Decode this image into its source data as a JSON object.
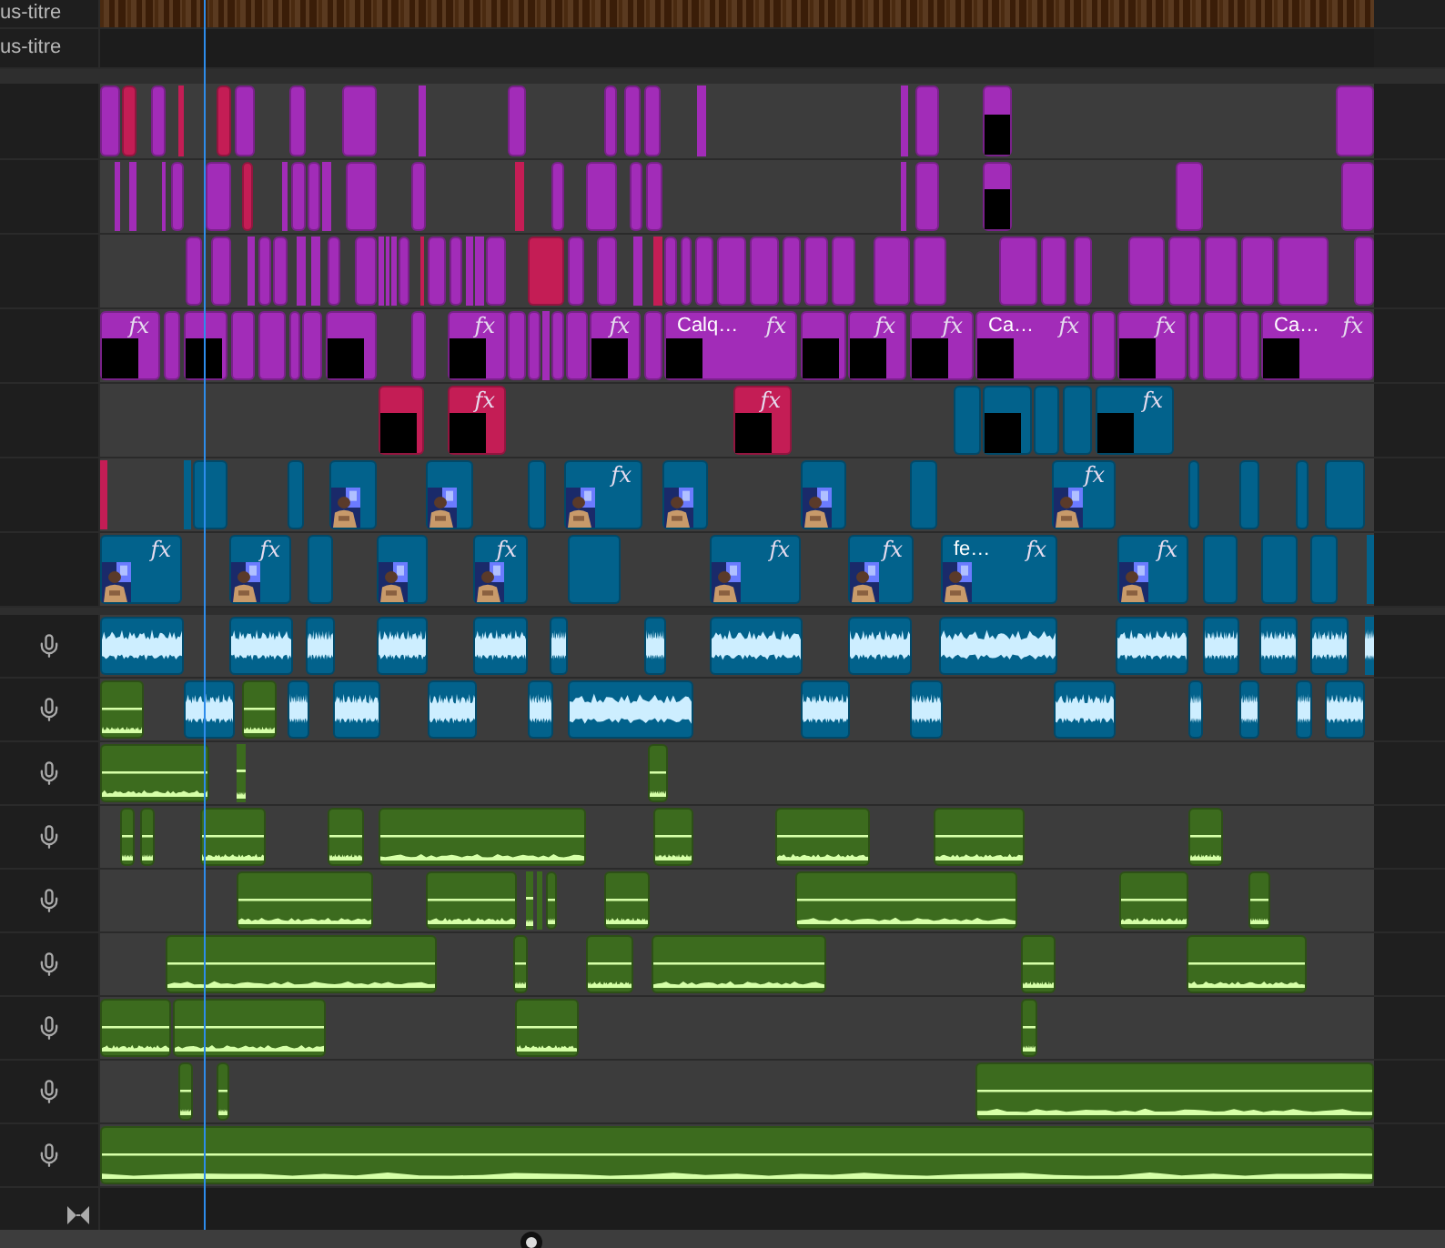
{
  "subtitle_tracks": [
    {
      "label": "us-titre"
    },
    {
      "label": "us-titre"
    }
  ],
  "video_tracks": [
    {
      "clips": [
        {
          "color": "#a22cb8"
        },
        {
          "color": "#c41d55"
        },
        {
          "color": "#a22cb8"
        },
        {
          "color": "#c41d55"
        },
        {
          "color": "#c41d55"
        },
        {
          "color": "#a22cb8"
        },
        {
          "color": "#a22cb8"
        },
        {
          "color": "#a22cb8"
        },
        {
          "color": "#a22cb8"
        },
        {
          "color": "#a22cb8"
        },
        {
          "color": "#a22cb8"
        },
        {
          "color": "#a22cb8"
        },
        {
          "color": "#a22cb8"
        },
        {
          "color": "#a22cb8"
        },
        {
          "color": "#a22cb8"
        },
        {
          "color": "#a22cb8"
        },
        {
          "color": "#a22cb8",
          "kind": "dark"
        },
        {
          "color": "#a22cb8"
        }
      ]
    },
    {
      "clips": [
        {
          "color": "#a22cb8"
        },
        {
          "color": "#a22cb8"
        },
        {
          "color": "#a22cb8"
        },
        {
          "color": "#a22cb8"
        },
        {
          "color": "#a22cb8"
        },
        {
          "color": "#c41d55"
        },
        {
          "color": "#a22cb8"
        },
        {
          "color": "#a22cb8"
        },
        {
          "color": "#a22cb8"
        },
        {
          "color": "#a22cb8"
        },
        {
          "color": "#a22cb8"
        },
        {
          "color": "#a22cb8"
        },
        {
          "color": "#c41d55"
        },
        {
          "color": "#a22cb8"
        },
        {
          "color": "#a22cb8"
        },
        {
          "color": "#a22cb8"
        },
        {
          "color": "#a22cb8"
        },
        {
          "color": "#a22cb8"
        },
        {
          "color": "#a22cb8"
        },
        {
          "color": "#a22cb8",
          "kind": "dark"
        },
        {
          "color": "#a22cb8"
        },
        {
          "color": "#a22cb8"
        }
      ]
    },
    {
      "clips": [
        {
          "color": "#a22cb8"
        },
        {
          "color": "#a22cb8"
        },
        {
          "color": "#a22cb8"
        },
        {
          "color": "#a22cb8"
        },
        {
          "color": "#a22cb8"
        },
        {
          "color": "#a22cb8"
        },
        {
          "color": "#a22cb8"
        },
        {
          "color": "#a22cb8"
        },
        {
          "color": "#a22cb8"
        },
        {
          "color": "#a22cb8"
        },
        {
          "color": "#a22cb8"
        },
        {
          "color": "#a22cb8"
        },
        {
          "color": "#a22cb8"
        },
        {
          "color": "#c41d55"
        },
        {
          "color": "#a22cb8"
        },
        {
          "color": "#a22cb8"
        },
        {
          "color": "#a22cb8"
        },
        {
          "color": "#a22cb8"
        },
        {
          "color": "#a22cb8"
        },
        {
          "color": "#c41d55"
        },
        {
          "color": "#a22cb8"
        },
        {
          "color": "#a22cb8"
        },
        {
          "color": "#a22cb8"
        },
        {
          "color": "#c41d55"
        },
        {
          "color": "#a22cb8"
        },
        {
          "color": "#a22cb8"
        },
        {
          "color": "#a22cb8"
        },
        {
          "color": "#a22cb8"
        },
        {
          "color": "#a22cb8"
        },
        {
          "color": "#a22cb8"
        },
        {
          "color": "#a22cb8"
        },
        {
          "color": "#a22cb8"
        },
        {
          "color": "#a22cb8"
        },
        {
          "color": "#a22cb8"
        },
        {
          "color": "#a22cb8"
        },
        {
          "color": "#a22cb8"
        },
        {
          "color": "#a22cb8"
        },
        {
          "color": "#a22cb8"
        },
        {
          "color": "#a22cb8"
        },
        {
          "color": "#a22cb8"
        },
        {
          "color": "#a22cb8"
        },
        {
          "color": "#a22cb8"
        },
        {
          "color": "#a22cb8"
        }
      ]
    },
    {
      "clips": [
        {
          "color": "#a22cb8",
          "effect": "fx",
          "kind": "dark"
        },
        {
          "color": "#a22cb8"
        },
        {
          "color": "#a22cb8",
          "kind": "dark"
        },
        {
          "color": "#a22cb8"
        },
        {
          "color": "#a22cb8"
        },
        {
          "color": "#a22cb8"
        },
        {
          "color": "#a22cb8"
        },
        {
          "color": "#a22cb8",
          "kind": "dark"
        },
        {
          "color": "#a22cb8"
        },
        {
          "color": "#a22cb8",
          "effect": "fx",
          "kind": "dark"
        },
        {
          "color": "#a22cb8"
        },
        {
          "color": "#a22cb8"
        },
        {
          "color": "#a22cb8"
        },
        {
          "color": "#a22cb8"
        },
        {
          "color": "#a22cb8"
        },
        {
          "color": "#a22cb8",
          "effect": "fx",
          "kind": "dark"
        },
        {
          "color": "#a22cb8"
        },
        {
          "color": "#a22cb8",
          "label": "Calq…",
          "effect": "fx",
          "kind": "dark"
        },
        {
          "color": "#a22cb8",
          "kind": "dark"
        },
        {
          "color": "#a22cb8",
          "effect": "fx",
          "kind": "dark"
        },
        {
          "color": "#a22cb8",
          "effect": "fx",
          "kind": "dark"
        },
        {
          "color": "#a22cb8",
          "label": "Ca…",
          "effect": "fx",
          "kind": "dark"
        },
        {
          "color": "#a22cb8"
        },
        {
          "color": "#a22cb8",
          "effect": "fx",
          "kind": "dark"
        },
        {
          "color": "#a22cb8"
        },
        {
          "color": "#a22cb8"
        },
        {
          "color": "#a22cb8"
        },
        {
          "color": "#a22cb8",
          "label": "Ca…",
          "effect": "fx",
          "kind": "dark"
        }
      ]
    },
    {
      "clips": [
        {
          "color": "#c41d55",
          "kind": "dark"
        },
        {
          "color": "#c41d55",
          "effect": "fx",
          "kind": "dark"
        },
        {
          "color": "#c41d55",
          "effect": "fx",
          "kind": "dark"
        },
        {
          "color": "#02628c"
        },
        {
          "color": "#02628c",
          "kind": "dark"
        },
        {
          "color": "#02628c"
        },
        {
          "color": "#02628c"
        },
        {
          "color": "#02628c",
          "effect": "fx",
          "kind": "dark"
        }
      ]
    },
    {
      "clips": [
        {
          "color": "#c41d55"
        },
        {
          "color": "#02628c"
        },
        {
          "color": "#02628c"
        },
        {
          "color": "#02628c"
        },
        {
          "color": "#02628c",
          "kind": "picture"
        },
        {
          "color": "#02628c",
          "kind": "picture"
        },
        {
          "color": "#02628c"
        },
        {
          "color": "#02628c",
          "effect": "fx",
          "kind": "picture"
        },
        {
          "color": "#02628c",
          "kind": "picture"
        },
        {
          "color": "#02628c",
          "kind": "picture"
        },
        {
          "color": "#02628c"
        },
        {
          "color": "#02628c",
          "effect": "fx",
          "kind": "picture"
        },
        {
          "color": "#02628c"
        },
        {
          "color": "#02628c"
        },
        {
          "color": "#02628c"
        },
        {
          "color": "#02628c"
        }
      ]
    },
    {
      "clips": [
        {
          "color": "#02628c",
          "effect": "fx",
          "kind": "picture"
        },
        {
          "color": "#02628c",
          "effect": "fx",
          "kind": "picture"
        },
        {
          "color": "#02628c"
        },
        {
          "color": "#02628c",
          "kind": "picture"
        },
        {
          "color": "#02628c",
          "effect": "fx",
          "kind": "picture"
        },
        {
          "color": "#02628c"
        },
        {
          "color": "#02628c",
          "effect": "fx",
          "kind": "picture"
        },
        {
          "color": "#02628c",
          "effect": "fx",
          "kind": "picture"
        },
        {
          "color": "#02628c",
          "label": "fe…",
          "effect": "fx",
          "kind": "picture"
        },
        {
          "color": "#02628c",
          "effect": "fx",
          "kind": "picture"
        },
        {
          "color": "#02628c"
        },
        {
          "color": "#02628c"
        },
        {
          "color": "#02628c"
        },
        {
          "color": "#02628c"
        }
      ]
    }
  ],
  "audio_tracks": [
    {
      "clips": [
        {
          "color": "#02628c"
        },
        {
          "color": "#02628c"
        },
        {
          "color": "#02628c"
        },
        {
          "color": "#02628c"
        },
        {
          "color": "#02628c"
        },
        {
          "color": "#02628c"
        },
        {
          "color": "#02628c"
        },
        {
          "color": "#02628c"
        },
        {
          "color": "#02628c"
        },
        {
          "color": "#02628c"
        },
        {
          "color": "#02628c"
        },
        {
          "color": "#02628c"
        },
        {
          "color": "#02628c"
        },
        {
          "color": "#02628c"
        },
        {
          "color": "#02628c"
        }
      ]
    },
    {
      "clips": [
        {
          "color": "#3c6b1e"
        },
        {
          "color": "#02628c"
        },
        {
          "color": "#3c6b1e"
        },
        {
          "color": "#02628c"
        },
        {
          "color": "#02628c"
        },
        {
          "color": "#02628c"
        },
        {
          "color": "#02628c"
        },
        {
          "color": "#02628c"
        },
        {
          "color": "#02628c"
        },
        {
          "color": "#02628c"
        },
        {
          "color": "#02628c"
        },
        {
          "color": "#02628c"
        },
        {
          "color": "#02628c"
        },
        {
          "color": "#02628c"
        },
        {
          "color": "#02628c"
        }
      ]
    },
    {
      "clips": [
        {
          "color": "#3c6b1e"
        },
        {
          "color": "#3c6b1e"
        },
        {
          "color": "#3c6b1e"
        }
      ]
    },
    {
      "clips": [
        {
          "color": "#3c6b1e"
        },
        {
          "color": "#3c6b1e"
        },
        {
          "color": "#3c6b1e"
        },
        {
          "color": "#3c6b1e"
        },
        {
          "color": "#3c6b1e"
        },
        {
          "color": "#3c6b1e"
        },
        {
          "color": "#3c6b1e"
        },
        {
          "color": "#3c6b1e"
        },
        {
          "color": "#3c6b1e"
        }
      ]
    },
    {
      "clips": [
        {
          "color": "#3c6b1e"
        },
        {
          "color": "#3c6b1e"
        },
        {
          "color": "#3c6b1e"
        },
        {
          "color": "#3c6b1e"
        },
        {
          "color": "#3c6b1e"
        },
        {
          "color": "#3c6b1e"
        },
        {
          "color": "#3c6b1e"
        },
        {
          "color": "#3c6b1e"
        },
        {
          "color": "#3c6b1e"
        }
      ]
    },
    {
      "clips": [
        {
          "color": "#3c6b1e"
        },
        {
          "color": "#3c6b1e"
        },
        {
          "color": "#3c6b1e"
        },
        {
          "color": "#3c6b1e"
        },
        {
          "color": "#3c6b1e"
        },
        {
          "color": "#3c6b1e"
        }
      ]
    },
    {
      "clips": [
        {
          "color": "#3c6b1e"
        },
        {
          "color": "#3c6b1e"
        },
        {
          "color": "#3c6b1e"
        },
        {
          "color": "#3c6b1e"
        }
      ]
    },
    {
      "clips": [
        {
          "color": "#3c6b1e"
        },
        {
          "color": "#3c6b1e"
        },
        {
          "color": "#3c6b1e"
        }
      ]
    },
    {
      "clips": [
        {
          "color": "#3c6b1e"
        }
      ]
    }
  ]
}
